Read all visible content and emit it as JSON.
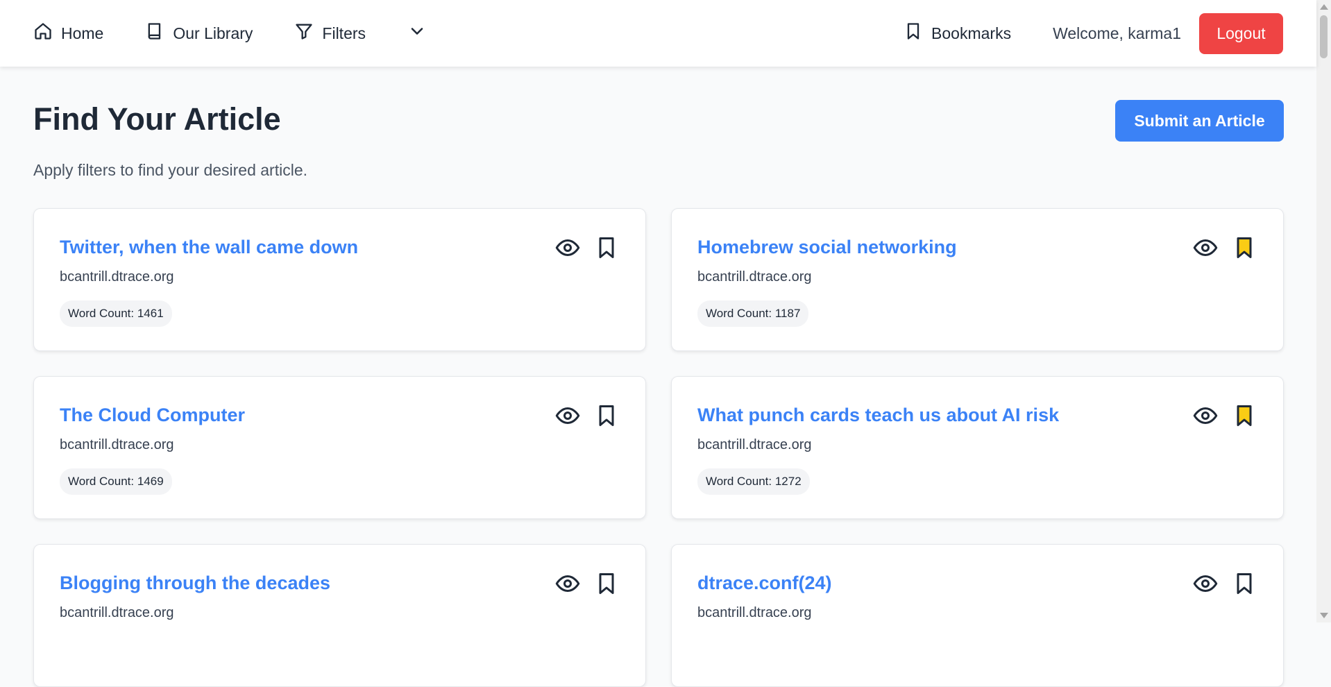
{
  "nav": {
    "home": "Home",
    "library": "Our Library",
    "filters": "Filters",
    "bookmarks": "Bookmarks",
    "welcome": "Welcome, karma1",
    "logout": "Logout"
  },
  "header": {
    "title": "Find Your Article",
    "subtitle": "Apply filters to find your desired article.",
    "submit_label": "Submit an Article"
  },
  "articles": [
    {
      "title": "Twitter, when the wall came down",
      "domain": "bcantrill.dtrace.org",
      "word_count": "Word Count: 1461",
      "bookmarked": false
    },
    {
      "title": "Homebrew social networking",
      "domain": "bcantrill.dtrace.org",
      "word_count": "Word Count: 1187",
      "bookmarked": true
    },
    {
      "title": "The Cloud Computer",
      "domain": "bcantrill.dtrace.org",
      "word_count": "Word Count: 1469",
      "bookmarked": false
    },
    {
      "title": "What punch cards teach us about AI risk",
      "domain": "bcantrill.dtrace.org",
      "word_count": "Word Count: 1272",
      "bookmarked": true
    },
    {
      "title": "Blogging through the decades",
      "domain": "bcantrill.dtrace.org",
      "word_count": "",
      "bookmarked": false
    },
    {
      "title": "dtrace.conf(24)",
      "domain": "bcantrill.dtrace.org",
      "word_count": "",
      "bookmarked": false
    }
  ],
  "colors": {
    "accent": "#3b82f6",
    "logout": "#ef4444",
    "bookmarked_fill": "#facc15"
  }
}
